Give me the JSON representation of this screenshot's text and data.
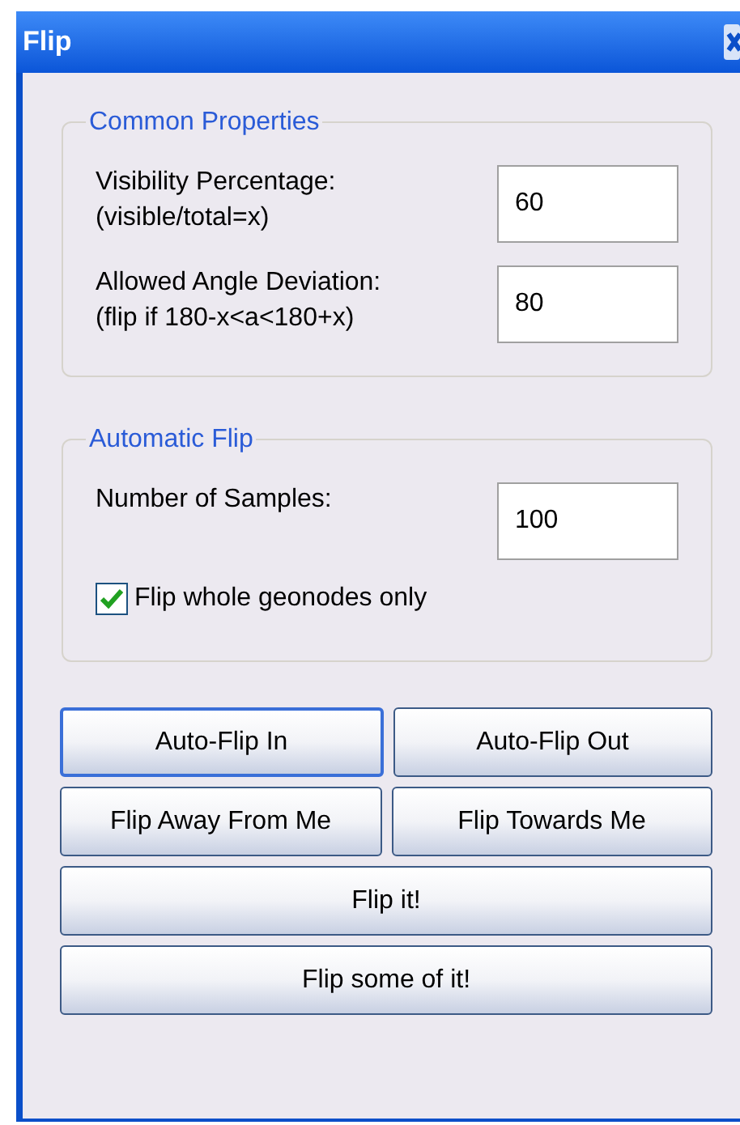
{
  "window": {
    "title": "Flip"
  },
  "groups": [
    {
      "title": "Common Properties",
      "fields": [
        {
          "label": "Visibility Percentage:",
          "hint": "(visible/total=x)",
          "value": "60"
        },
        {
          "label": "Allowed Angle Deviation:",
          "hint": "(flip if 180-x<a<180+x)",
          "value": "80"
        }
      ]
    },
    {
      "title": "Automatic Flip",
      "fields": [
        {
          "label": "Number of Samples:",
          "value": "100"
        }
      ],
      "checkbox": {
        "label": "Flip whole geonodes only",
        "checked": true
      }
    }
  ],
  "button_rows": [
    [
      {
        "label": "Auto-Flip In",
        "default": true
      },
      {
        "label": "Auto-Flip Out",
        "default": false
      }
    ],
    [
      {
        "label": "Flip Away From Me",
        "default": false
      },
      {
        "label": "Flip Towards Me",
        "default": false
      }
    ],
    [
      {
        "label": "Flip it!",
        "default": false
      }
    ],
    [
      {
        "label": "Flip some of it!",
        "default": false
      }
    ]
  ]
}
